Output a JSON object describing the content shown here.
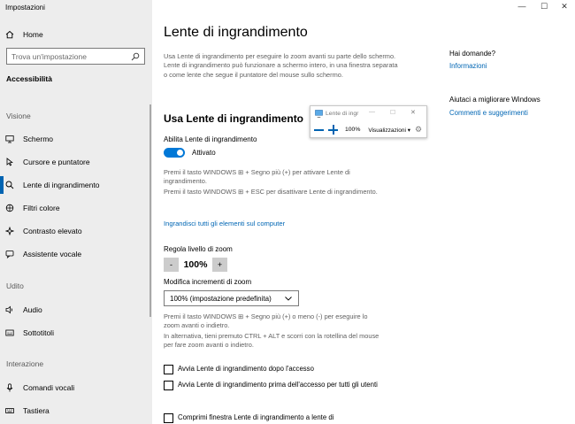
{
  "window": {
    "title": "Impostazioni",
    "minimize": "—",
    "maximize": "☐",
    "close": "✕"
  },
  "sidebar": {
    "home": "Home",
    "search_placeholder": "Trova un'impostazione",
    "category": "Accessibilità",
    "sections": {
      "vision": "Visione",
      "hearing": "Udito",
      "interaction": "Interazione"
    },
    "items": [
      {
        "label": "Schermo",
        "icon": "monitor-icon"
      },
      {
        "label": "Cursore e puntatore",
        "icon": "cursor-icon"
      },
      {
        "label": "Lente di ingrandimento",
        "icon": "magnifier-icon"
      },
      {
        "label": "Filtri colore",
        "icon": "color-filter-icon"
      },
      {
        "label": "Contrasto elevato",
        "icon": "contrast-icon"
      },
      {
        "label": "Assistente vocale",
        "icon": "narrator-icon"
      },
      {
        "label": "Audio",
        "icon": "speaker-icon"
      },
      {
        "label": "Sottotitoli",
        "icon": "captions-icon"
      },
      {
        "label": "Comandi vocali",
        "icon": "microphone-icon"
      },
      {
        "label": "Tastiera",
        "icon": "keyboard-icon"
      }
    ]
  },
  "main": {
    "title": "Lente di ingrandimento",
    "description": "Usa Lente di ingrandimento per eseguire lo zoom avanti su parte dello schermo. Lente di ingrandimento può funzionare a schermo intero, in una finestra separata o come lente che segue il puntatore del mouse sullo schermo.",
    "section_title": "Usa Lente di ingrandimento",
    "enable_label": "Abilita Lente di ingrandimento",
    "toggle_state": "Attivato",
    "help_line1": "Premi il tasto WINDOWS ⊞ + Segno più (+) per attivare Lente di ingrandimento.",
    "help_line2": "Premi il tasto WINDOWS ⊞ + ESC per disattivare Lente di ingrandimento.",
    "link_zoom_all": "Ingrandisci tutti gli elementi sul computer",
    "zoom_level_label": "Regola livello di zoom",
    "zoom_minus": "-",
    "zoom_value": "100%",
    "zoom_plus": "+",
    "increment_label": "Modifica incrementi di zoom",
    "increment_value": "100% (impostazione predefinita)",
    "zoom_help1": "Premi il tasto WINDOWS ⊞ + Segno più (+) o meno (-) per eseguire lo zoom avanti o indietro.",
    "zoom_help2": "In alternativa, tieni premuto CTRL + ALT e scorri con la rotellina del mouse per fare zoom avanti o indietro.",
    "checkboxes": [
      {
        "label": "Avvia Lente di ingrandimento dopo l'accesso",
        "checked": false
      },
      {
        "label": "Avvia Lente di ingrandimento prima dell'accesso per tutti gli utenti",
        "checked": false
      },
      {
        "label": "Comprimi finestra Lente di ingrandimento a lente di",
        "checked": false
      }
    ]
  },
  "right": {
    "questions_title": "Hai domande?",
    "info_link": "Informazioni",
    "improve_title": "Aiutaci a migliorare Windows",
    "feedback_link": "Commenti e suggerimenti"
  },
  "magnifier": {
    "title": "Lente di ingr",
    "zoom": "100%",
    "views": "Visualizzazioni",
    "accent_color": "#0063b1"
  },
  "colors": {
    "accent": "#0078d7",
    "link": "#0066b4",
    "sidebar_bg": "#ededed"
  }
}
